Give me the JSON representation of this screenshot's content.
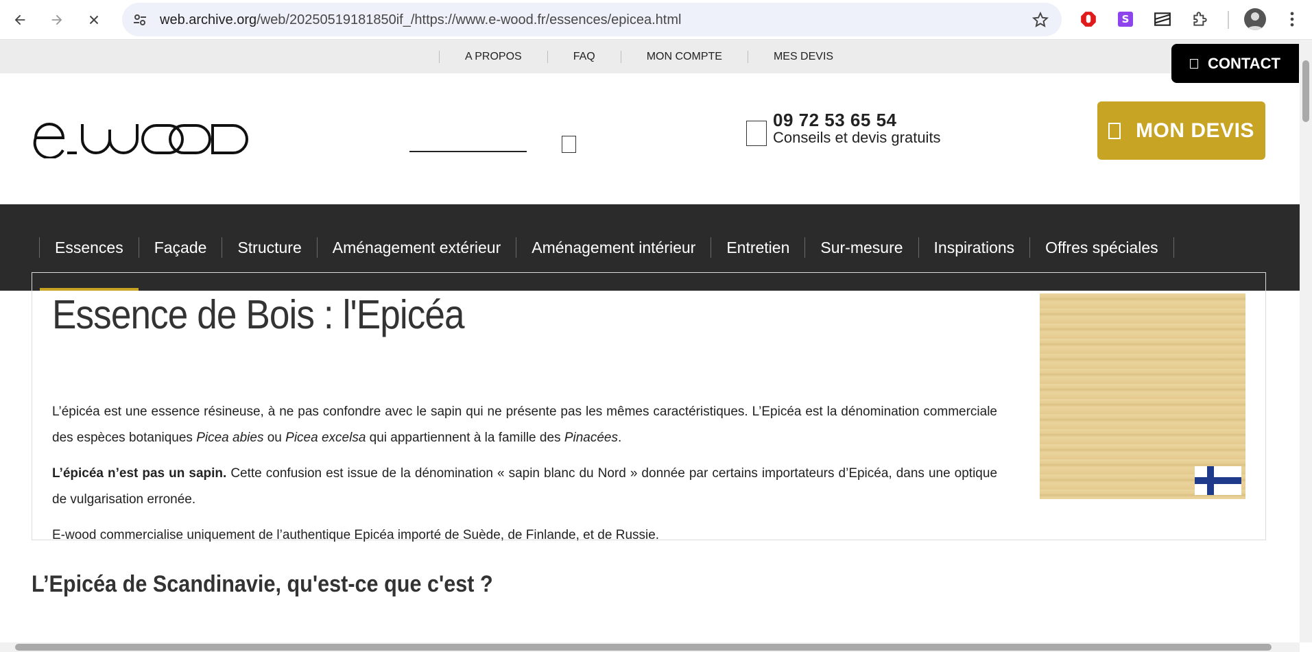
{
  "browser": {
    "url_host": "web.archive.org",
    "url_path": "/web/20250519181850if_/https://www.e-wood.fr/essences/epicea.html",
    "icons": [
      "back-icon",
      "forward-icon",
      "stop-icon",
      "site-settings-icon",
      "bookmark-star-icon",
      "adblock-extension-icon",
      "s-extension-icon",
      "media-extension-icon",
      "extensions-puzzle-icon",
      "profile-avatar",
      "menu-kebab-icon"
    ]
  },
  "topbar": {
    "links": [
      "A PROPOS",
      "FAQ",
      "MON COMPTE",
      "MES DEVIS"
    ],
    "contact_label": "CONTACT"
  },
  "header": {
    "logo_text": "e.wood",
    "phone": "09 72 53 65 54",
    "phone_sub": "Conseils et devis gratuits",
    "devis_label": "MON DEVIS",
    "brand_color": "#c8a425"
  },
  "nav": {
    "items": [
      "Essences",
      "Façade",
      "Structure",
      "Aménagement extérieur",
      "Aménagement intérieur",
      "Entretien",
      "Sur-mesure",
      "Inspirations",
      "Offres spéciales"
    ],
    "active": "Essences"
  },
  "content": {
    "title": "Essence de Bois : l'Epicéa",
    "p1_a": "L’épicéa est une essence résineuse, à ne pas confondre avec le sapin qui ne présente pas les mêmes caractéristiques. L’Epicéa est la dénomination commerciale des espèces botaniques ",
    "p1_i1": "Picea abies",
    "p1_b": " ou ",
    "p1_i2": "Picea excelsa",
    "p1_c": " qui appartiennent à la famille des ",
    "p1_i3": "Pinacées",
    "p1_d": ".",
    "p2_bold": "L’épicéa n’est pas un sapin.",
    "p2_rest": " Cette confusion est issue de la dénomination « sapin blanc du Nord » donnée par certains importateurs d’Epicéa, dans une optique de vulgarisation erronée.",
    "p3": "E-wood commercialise uniquement de l’authentique Epicéa importé de Suède, de Finlande, et de Russie.",
    "section_title": "L’Epicéa de Scandinavie, qu'est-ce que c'est ?"
  }
}
